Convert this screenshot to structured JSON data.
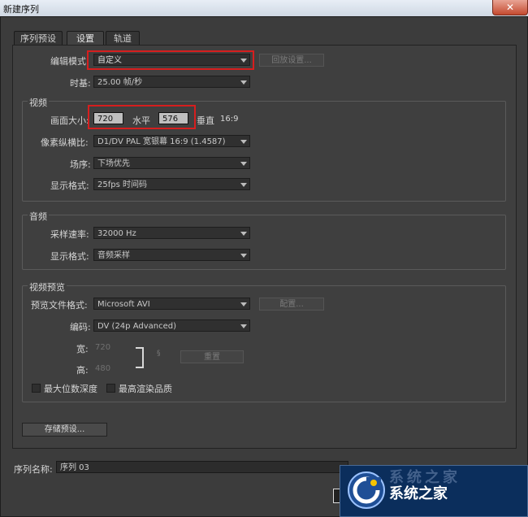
{
  "window": {
    "title": "新建序列",
    "close_glyph": "✕"
  },
  "tabs": [
    {
      "label": "序列预设"
    },
    {
      "label": "设置"
    },
    {
      "label": "轨道"
    }
  ],
  "edit": {
    "mode_label": "编辑模式:",
    "mode_value": "自定义",
    "playback_button": "回放设置...",
    "timebase_label": "时基:",
    "timebase_value": "25.00 帧/秒"
  },
  "video": {
    "title": "视频",
    "frame_size_label": "画面大小:",
    "width_value": "720",
    "horizontal_label": "水平",
    "height_value": "576",
    "vertical_label": "垂直",
    "aspect": "16:9",
    "pixel_aspect_label": "像素纵横比:",
    "pixel_aspect_value": "D1/DV PAL 宽银幕 16:9 (1.4587)",
    "fields_label": "场序:",
    "fields_value": "下场优先",
    "display_format_label": "显示格式:",
    "display_format_value": "25fps 时间码"
  },
  "audio": {
    "title": "音频",
    "sample_rate_label": "采样速率:",
    "sample_rate_value": "32000 Hz",
    "display_format_label": "显示格式:",
    "display_format_value": "音频采样"
  },
  "preview": {
    "title": "视频预览",
    "file_format_label": "预览文件格式:",
    "file_format_value": "Microsoft AVI",
    "configure_button": "配置...",
    "codec_label": "编码:",
    "codec_value": "DV (24p Advanced)",
    "width_label": "宽:",
    "width_value": "720",
    "height_label": "高:",
    "height_value": "480",
    "reset_button": "重置",
    "max_bit_depth_label": "最大位数深度",
    "max_render_quality_label": "最高渲染品质"
  },
  "save_preset_button": "存储预设...",
  "sequence_name_label": "序列名称:",
  "sequence_name_value": "序列 03",
  "watermark": {
    "text": "系统之家",
    "ghost_text": "系统之家"
  },
  "colors": {
    "highlight_box": "#d61e1e",
    "watermark_bg": "#0b2e5c"
  }
}
